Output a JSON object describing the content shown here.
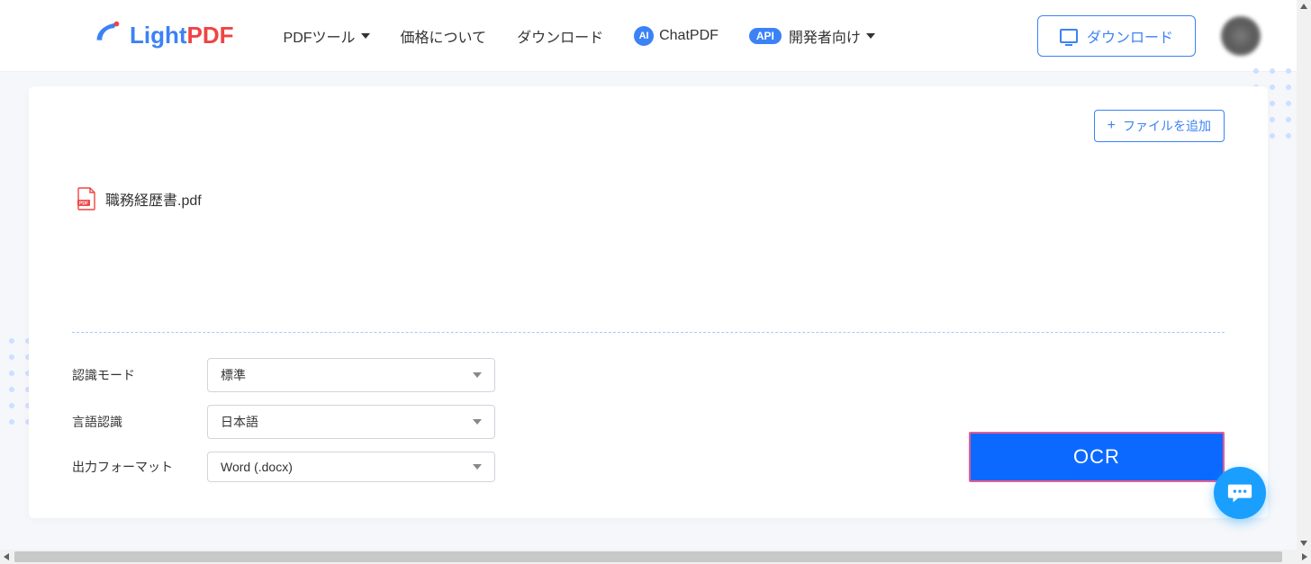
{
  "logo": {
    "light": "Light",
    "pdf": "PDF"
  },
  "nav": {
    "pdf_tools": "PDFツール",
    "pricing": "価格について",
    "download": "ダウンロード",
    "ai_badge": "AI",
    "chatpdf": "ChatPDF",
    "api_badge": "API",
    "developers": "開発者向け"
  },
  "header": {
    "download_button": "ダウンロード"
  },
  "card": {
    "add_file": "ファイルを追加",
    "file_name": "職務経歴書.pdf"
  },
  "options": {
    "mode_label": "認識モード",
    "mode_value": "標準",
    "language_label": "言語認識",
    "language_value": "日本語",
    "format_label": "出力フォーマット",
    "format_value": "Word (.docx)"
  },
  "actions": {
    "ocr": "OCR"
  }
}
